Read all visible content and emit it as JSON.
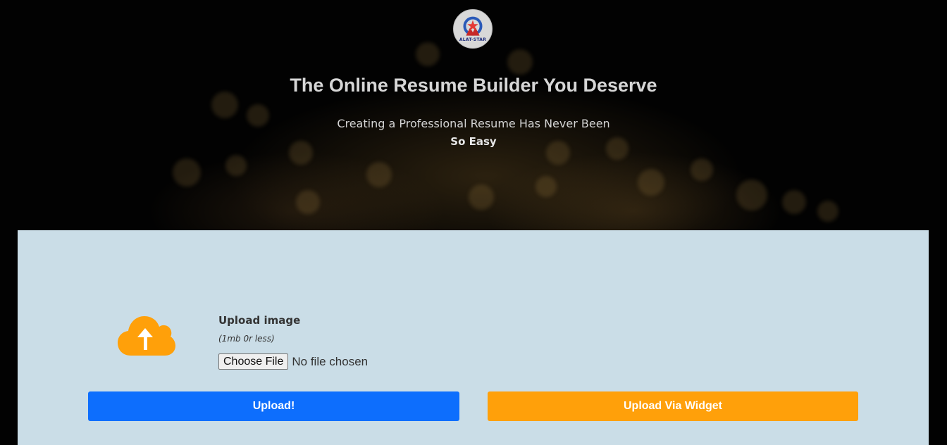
{
  "header": {
    "logo_text": "ALAT-STAR",
    "title": "The Online Resume Builder You Deserve",
    "subtitle": "Creating a Professional Resume Has Never Been",
    "emphasis": "So Easy"
  },
  "upload": {
    "icon": "cloud-upload-icon",
    "title": "Upload image",
    "note": "(1mb 0r less)",
    "choose_file_label": "Choose File",
    "file_status": "No file chosen",
    "upload_button": "Upload!",
    "widget_button": "Upload Via Widget"
  },
  "colors": {
    "primary_button": "#0d6efd",
    "widget_button": "#ffa00a",
    "icon": "#ffa00a",
    "panel": "#cadde7"
  }
}
